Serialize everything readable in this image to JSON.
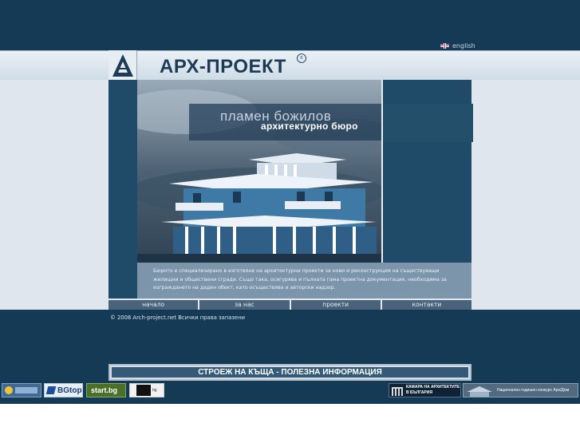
{
  "header": {
    "language_label": "english",
    "brand": "АРХ-ПРОЕКТ",
    "registered_mark": "R"
  },
  "hero": {
    "name": "пламен божилов",
    "subtitle": "архитектурно бюро"
  },
  "description": "Бюрото е специализирано в изготвяне на архитектурни проекти за нови и реконструкция на съществуващи жилищни и обществени сгради. Също така, осигурява и пълната гама проектна документация, необходима за изграждането на даден обект, като осъществява и авторски надзор.",
  "nav": {
    "items": [
      "начало",
      "за нас",
      "проекти",
      "контакти"
    ]
  },
  "footer": {
    "copyright": "© 2008 Arch-project.net   Всички права запазени",
    "info_link": "СТРОЕЖ НА КЪЩА - ПОЛЕЗНА ИНФОРМАЦИЯ"
  },
  "badges": {
    "bgtop": "BGtop",
    "startbg": "start.bg",
    "arhbg": "bg",
    "chamber_line1": "КАМАРА НА АРХИТЕКТИТЕ",
    "chamber_line2": "В БЪЛГАРИЯ",
    "competition": "Национален годишен конкурс Арх/Дом"
  },
  "colors": {
    "page_dark": "#153a56",
    "accent": "#1f4b68",
    "nav": "#48637a"
  },
  "icons": [
    "uk-flag-icon",
    "logo-triangle-icon",
    "house-render-image"
  ]
}
